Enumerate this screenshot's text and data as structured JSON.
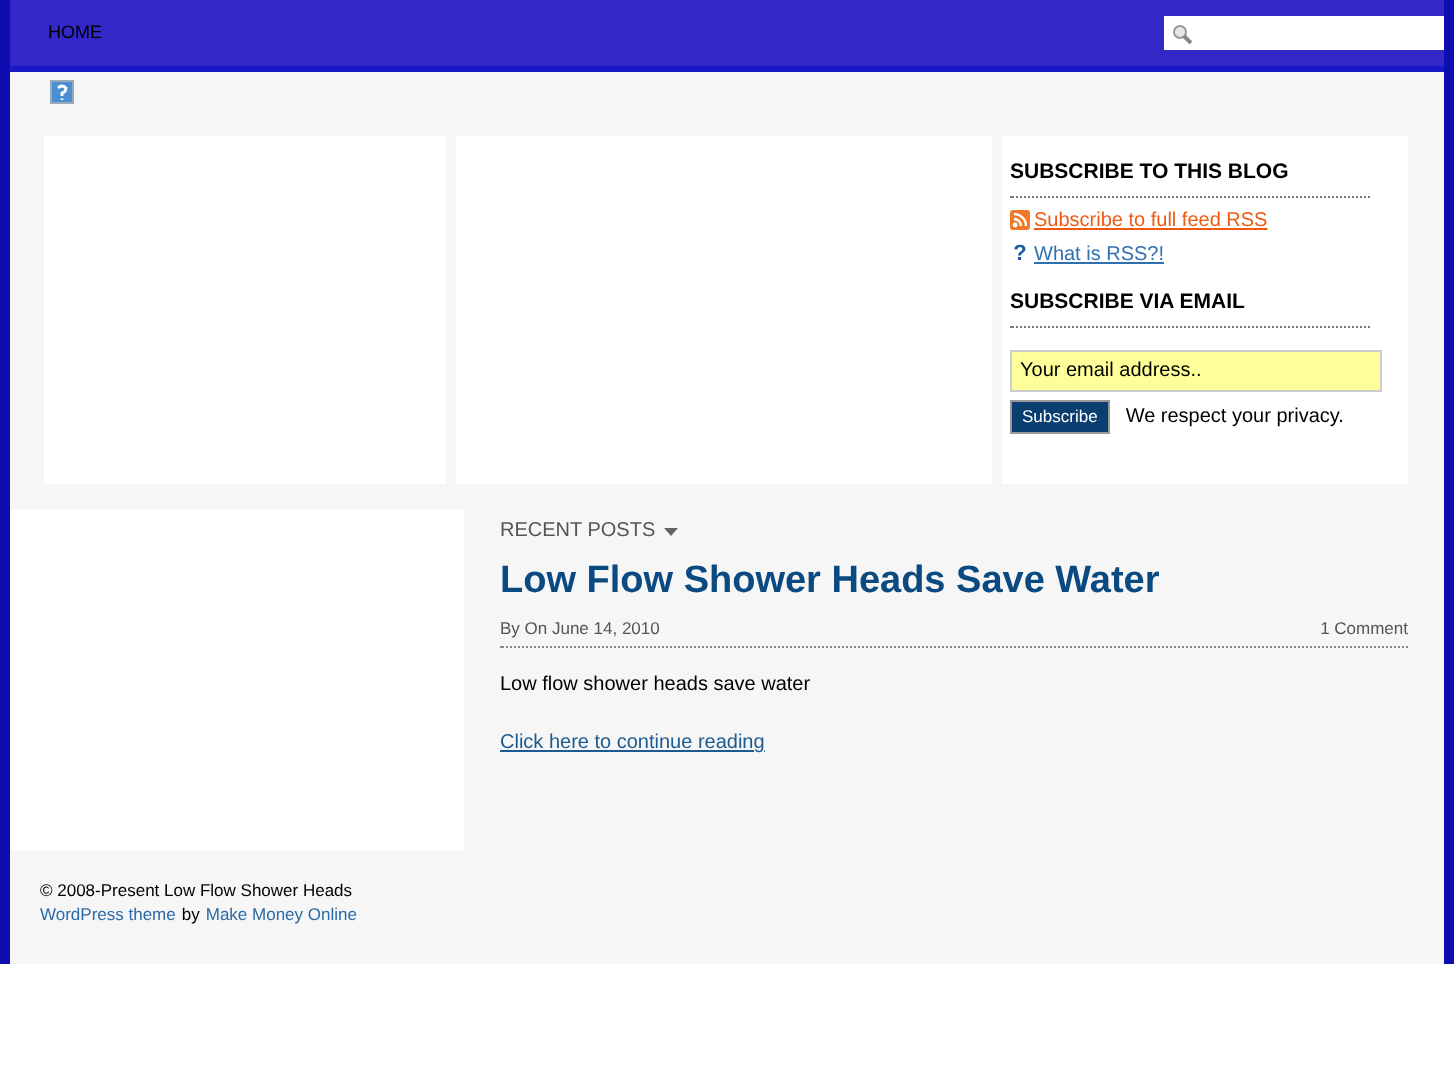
{
  "nav": {
    "items": [
      {
        "label": "HOME",
        "selected": false
      }
    ]
  },
  "sidebar": {
    "subscribe_title": "SUBSCRIBE TO THIS BLOG",
    "links": [
      {
        "kind": "rss",
        "label": "Subscribe to full feed RSS"
      },
      {
        "kind": "help",
        "icon": "?",
        "label": "What is RSS?!"
      }
    ],
    "email_title": "SUBSCRIBE VIA EMAIL",
    "email_placeholder": "Your email address..",
    "button": "Subscribe",
    "privacy": "We respect your privacy."
  },
  "recent_posts": {
    "heading": "RECENT POSTS",
    "posts": [
      {
        "title": "Low Flow Shower Heads Save Water",
        "meta": "By On June 14, 2010",
        "comments": "1 Comment",
        "excerpt": "Low flow shower heads save water",
        "more": "Click here to continue reading"
      }
    ]
  },
  "footer": {
    "copyright": "© 2008-Present Low Flow Shower Heads",
    "theme_link": "WordPress theme",
    "by": "by",
    "author_link": "Make Money Online"
  }
}
